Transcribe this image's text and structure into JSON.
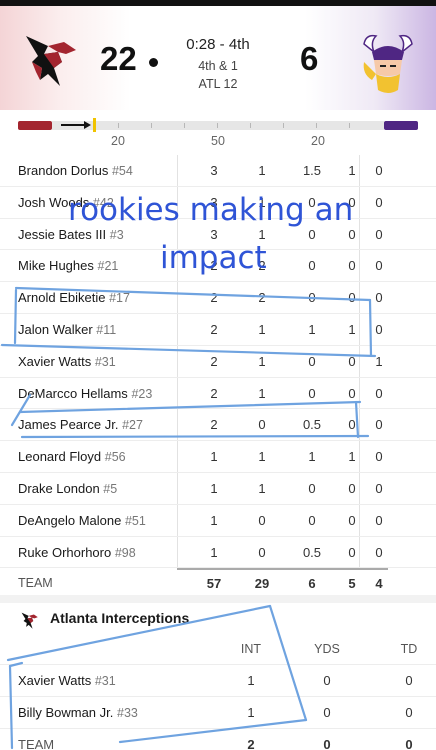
{
  "game": {
    "home_score": "22",
    "away_score": "6",
    "clock": "0:28 - 4th",
    "down_distance": "4th & 1",
    "ball_spot": "ATL 12",
    "home_color": "#a3252f",
    "away_color": "#4f2683"
  },
  "field": {
    "yard_labels": [
      "20",
      "50",
      "20"
    ]
  },
  "defense": {
    "rows": [
      {
        "name": "Brandon Dorlus",
        "number": "#54",
        "v": [
          "3",
          "1",
          "1.5",
          "1",
          "0"
        ]
      },
      {
        "name": "Josh Woods",
        "number": "#42",
        "v": [
          "3",
          "1",
          "0",
          "0",
          "0"
        ]
      },
      {
        "name": "Jessie Bates III",
        "number": "#3",
        "v": [
          "3",
          "1",
          "0",
          "0",
          "0"
        ]
      },
      {
        "name": "Mike Hughes",
        "number": "#21",
        "v": [
          "2",
          "2",
          "0",
          "0",
          "0"
        ]
      },
      {
        "name": "Arnold Ebiketie",
        "number": "#17",
        "v": [
          "2",
          "2",
          "0",
          "0",
          "0"
        ]
      },
      {
        "name": "Jalon Walker",
        "number": "#11",
        "v": [
          "2",
          "1",
          "1",
          "1",
          "0"
        ]
      },
      {
        "name": "Xavier Watts",
        "number": "#31",
        "v": [
          "2",
          "1",
          "0",
          "0",
          "1"
        ]
      },
      {
        "name": "DeMarcco Hellams",
        "number": "#23",
        "v": [
          "2",
          "1",
          "0",
          "0",
          "0"
        ]
      },
      {
        "name": "James Pearce Jr.",
        "number": "#27",
        "v": [
          "2",
          "0",
          "0.5",
          "0",
          "0"
        ]
      },
      {
        "name": "Leonard Floyd",
        "number": "#56",
        "v": [
          "1",
          "1",
          "1",
          "1",
          "0"
        ]
      },
      {
        "name": "Drake London",
        "number": "#5",
        "v": [
          "1",
          "1",
          "0",
          "0",
          "0"
        ]
      },
      {
        "name": "DeAngelo Malone",
        "number": "#51",
        "v": [
          "1",
          "0",
          "0",
          "0",
          "0"
        ]
      },
      {
        "name": "Ruke Orhorhoro",
        "number": "#98",
        "v": [
          "1",
          "0",
          "0.5",
          "0",
          "0"
        ]
      }
    ],
    "team": {
      "label": "TEAM",
      "v": [
        "57",
        "29",
        "6",
        "5",
        "4"
      ]
    }
  },
  "interceptions": {
    "title": "Atlanta Interceptions",
    "headers": [
      "INT",
      "YDS",
      "TD"
    ],
    "rows": [
      {
        "name": "Xavier Watts",
        "number": "#31",
        "v": [
          "1",
          "0",
          "0"
        ]
      },
      {
        "name": "Billy Bowman Jr.",
        "number": "#33",
        "v": [
          "1",
          "0",
          "0"
        ]
      }
    ],
    "team": {
      "label": "TEAM",
      "v": [
        "2",
        "0",
        "0"
      ]
    }
  },
  "annotation": {
    "line1": "rookies making an",
    "line2": "impact",
    "color": "#2f54d6"
  }
}
